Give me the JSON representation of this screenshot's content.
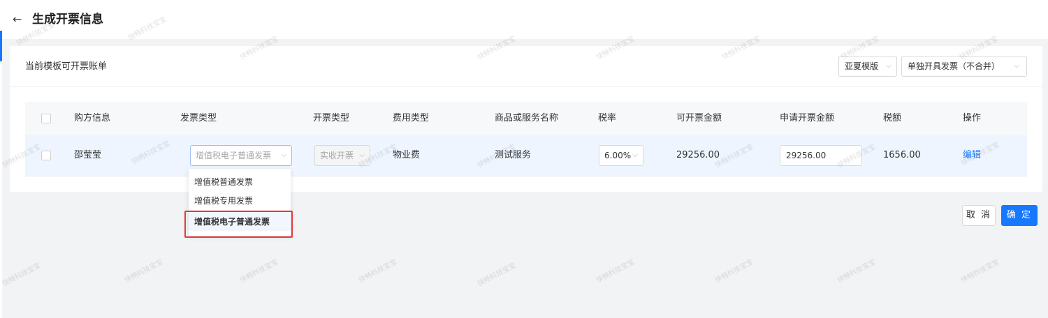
{
  "header": {
    "back_icon": "←",
    "title": "生成开票信息"
  },
  "card": {
    "title": "当前模板可开票账单",
    "template_select": "亚夏模版",
    "mode_select": "单独开具发票（不合并）"
  },
  "table": {
    "columns": [
      "购方信息",
      "发票类型",
      "开票类型",
      "费用类型",
      "商品或服务名称",
      "税率",
      "可开票金额",
      "申请开票金额",
      "税额",
      "操作"
    ],
    "rows": [
      {
        "buyer": "邵莹莹",
        "invoice_type": "增值税电子普通发票",
        "issue_type": "实收开票",
        "fee_type": "物业费",
        "service_name": "测试服务",
        "tax_rate": "6.00%",
        "invoicable_amount": "29256.00",
        "apply_amount": "29256.00",
        "tax_amount": "1656.00",
        "action": "编辑"
      }
    ]
  },
  "dropdown": {
    "options": [
      "增值税普通发票",
      "增值税专用发票",
      "增值税电子普通发票"
    ],
    "selected_index": 2
  },
  "footer": {
    "cancel_label": "取 消",
    "confirm_label": "确 定"
  },
  "watermark": "快畅科技宝宝",
  "icons": {
    "chevron": "⌵"
  },
  "colors": {
    "primary": "#1677ff",
    "highlight": "#e53935"
  }
}
